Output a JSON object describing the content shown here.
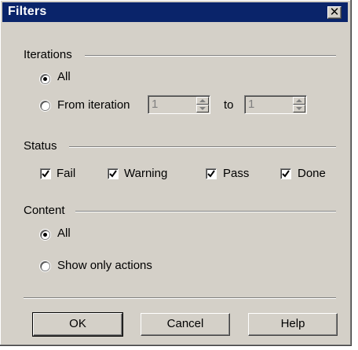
{
  "window": {
    "title": "Filters",
    "close_glyph": "✕"
  },
  "iterations": {
    "label": "Iterations",
    "all_label": "All",
    "all_selected": true,
    "from_label": "From iteration",
    "from_selected": false,
    "from_value": "1",
    "to_label": "to",
    "to_value": "1"
  },
  "status": {
    "label": "Status",
    "items": [
      {
        "label": "Fail",
        "checked": true
      },
      {
        "label": "Warning",
        "checked": true
      },
      {
        "label": "Pass",
        "checked": true
      },
      {
        "label": "Done",
        "checked": true
      }
    ]
  },
  "content": {
    "label": "Content",
    "all_label": "All",
    "all_selected": true,
    "actions_label": "Show only actions",
    "actions_selected": false
  },
  "buttons": {
    "ok": "OK",
    "cancel": "Cancel",
    "help": "Help"
  }
}
